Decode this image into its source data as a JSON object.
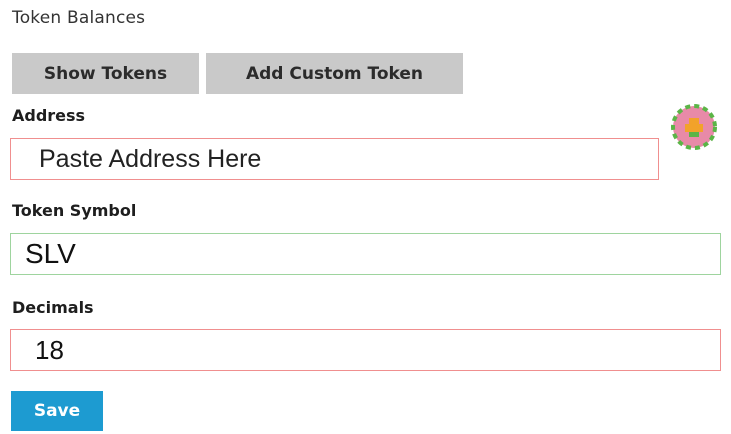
{
  "section": {
    "title": "Token Balances"
  },
  "tabs": [
    {
      "label": "Show Tokens"
    },
    {
      "label": "Add Custom Token"
    }
  ],
  "form": {
    "address": {
      "label": "Address",
      "placeholder": "Paste Address Here",
      "value": ""
    },
    "symbol": {
      "label": "Token Symbol",
      "value": "SLV"
    },
    "decimals": {
      "label": "Decimals",
      "value": "18"
    }
  },
  "save": {
    "label": "Save"
  },
  "avatar": {
    "icon": "identicon",
    "colors": [
      "#e88aa8",
      "#5bb547",
      "#f2a22a"
    ]
  },
  "colors": {
    "invalid_border": "#f08f8f",
    "valid_border": "#9ed49e",
    "save_bg": "#1d9bd1",
    "tab_bg": "#c9c9c9"
  }
}
